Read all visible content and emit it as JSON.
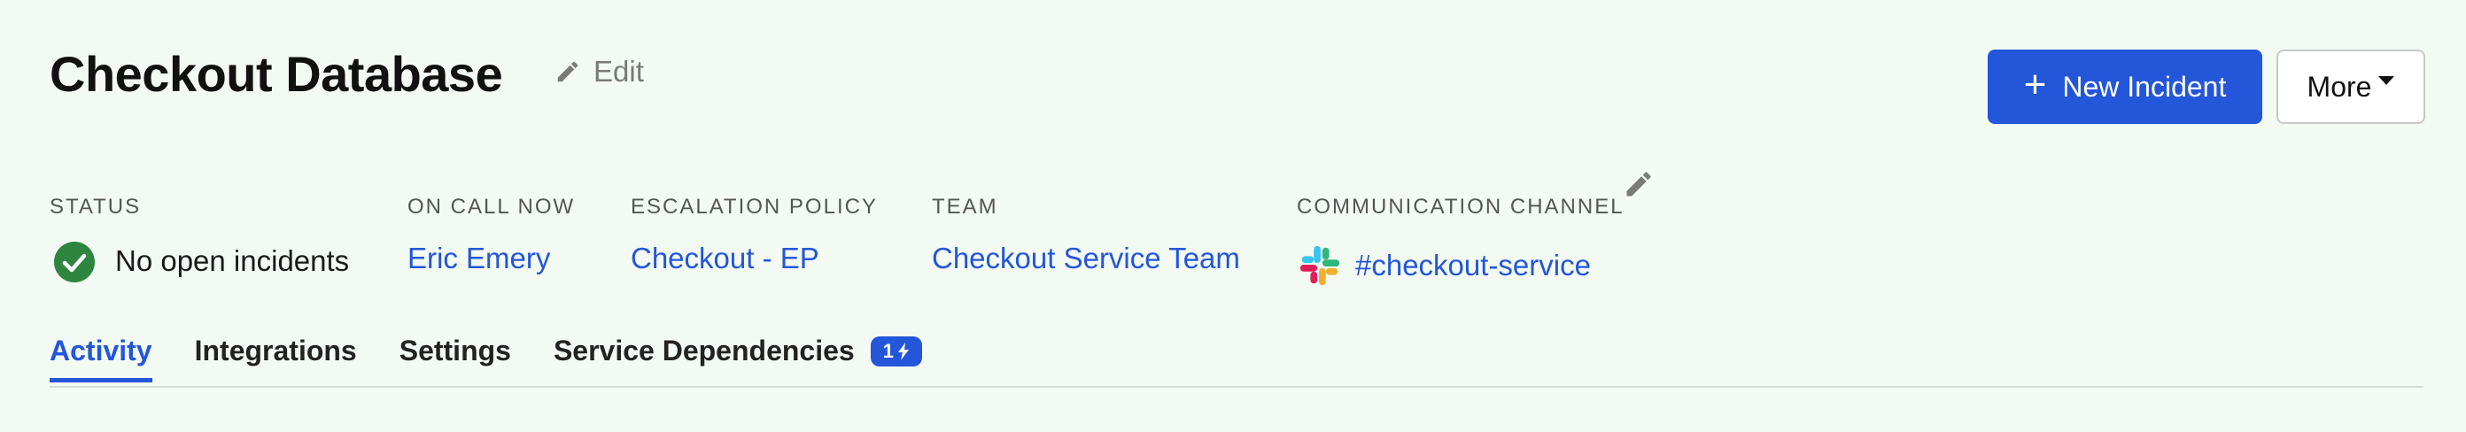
{
  "header": {
    "title": "Checkout Database",
    "edit_label": "Edit",
    "new_incident_label": "New Incident",
    "more_label": "More"
  },
  "fields": {
    "status": {
      "label": "STATUS",
      "value": "No open incidents"
    },
    "on_call": {
      "label": "ON CALL NOW",
      "value": "Eric Emery"
    },
    "escalation": {
      "label": "ESCALATION POLICY",
      "value": "Checkout - EP"
    },
    "team": {
      "label": "TEAM",
      "value": "Checkout Service Team"
    },
    "channel": {
      "label": "COMMUNICATION CHANNEL",
      "value": "#checkout-service"
    }
  },
  "tabs": [
    {
      "label": "Activity",
      "active": true
    },
    {
      "label": "Integrations"
    },
    {
      "label": "Settings"
    },
    {
      "label": "Service Dependencies",
      "badge": "1"
    }
  ],
  "icons": {
    "edit": "pencil-icon",
    "status": "check-circle-icon",
    "channel": "slack-icon",
    "badge": "lightning-icon"
  },
  "colors": {
    "accent": "#2356d9",
    "success": "#2e8540",
    "background": "#f3faf3"
  }
}
